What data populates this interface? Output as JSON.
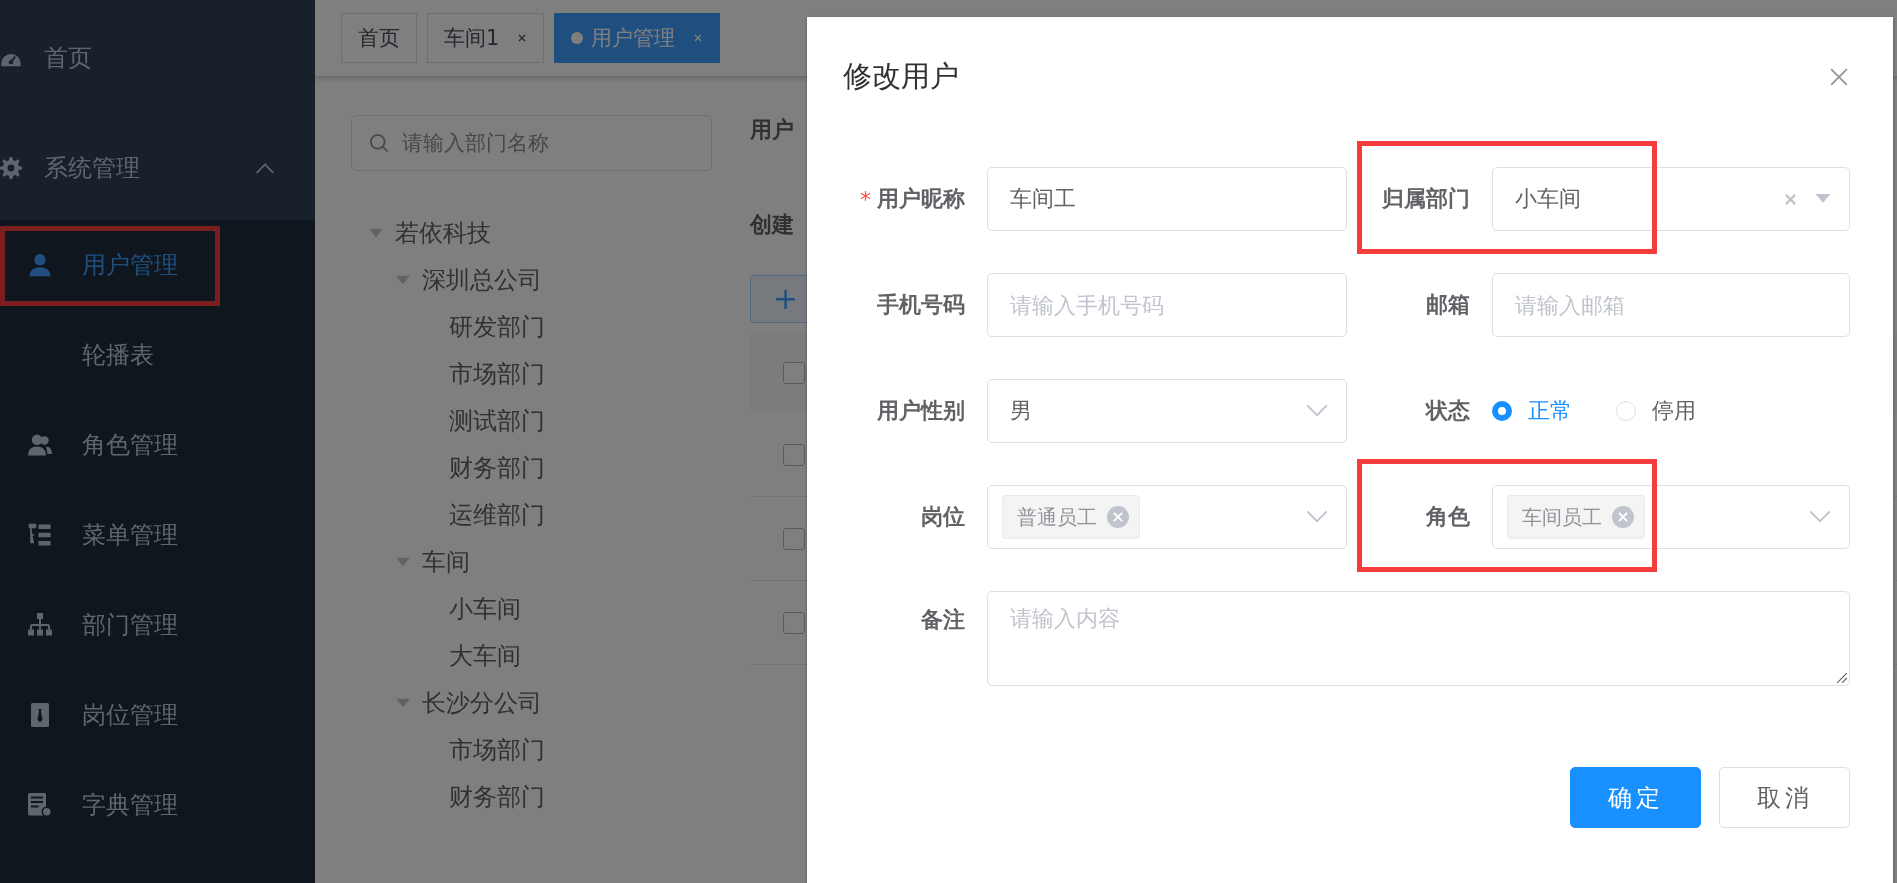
{
  "sidebar": {
    "items": [
      {
        "label": "首页",
        "selected": false
      },
      {
        "label": "系统管理",
        "selected": false,
        "expanded": true,
        "children": [
          {
            "label": "用户管理",
            "selected": true,
            "highlighted": true
          },
          {
            "label": "轮播表",
            "selected": false
          },
          {
            "label": "角色管理",
            "selected": false
          },
          {
            "label": "菜单管理",
            "selected": false
          },
          {
            "label": "部门管理",
            "selected": false
          },
          {
            "label": "岗位管理",
            "selected": false
          },
          {
            "label": "字典管理",
            "selected": false
          }
        ]
      }
    ]
  },
  "tags": [
    {
      "label": "首页",
      "selected": false,
      "closable": false
    },
    {
      "label": "车间1",
      "selected": false,
      "closable": true
    },
    {
      "label": "用户管理",
      "selected": true,
      "closable": true
    }
  ],
  "dept_search": {
    "placeholder": "请输入部门名称"
  },
  "dept_tree": [
    {
      "label": "若依科技",
      "expanded": true,
      "children": [
        {
          "label": "深圳总公司",
          "expanded": true,
          "children": [
            {
              "label": "研发部门"
            },
            {
              "label": "市场部门"
            },
            {
              "label": "测试部门"
            },
            {
              "label": "财务部门"
            },
            {
              "label": "运维部门"
            }
          ]
        },
        {
          "label": "车间",
          "expanded": true,
          "children": [
            {
              "label": "小车间"
            },
            {
              "label": "大车间"
            }
          ]
        },
        {
          "label": "长沙分公司",
          "expanded": true,
          "children": [
            {
              "label": "市场部门"
            },
            {
              "label": "财务部门"
            }
          ]
        }
      ]
    }
  ],
  "query_labels": [
    "用户",
    "创建"
  ],
  "add_button": {
    "label": "+"
  },
  "table": {
    "header_checked": false,
    "rows": [
      {
        "checked": false
      },
      {
        "checked": false
      },
      {
        "checked": false
      }
    ]
  },
  "dialog": {
    "title": "修改用户",
    "fields": [
      {
        "kind": "input",
        "label": "用户昵称",
        "required_mark": "*",
        "value": "车间工"
      },
      {
        "kind": "tree-select",
        "label": "归属部门",
        "value": "小车间",
        "clearable": true,
        "highlighted": true
      },
      {
        "kind": "input",
        "label": "手机号码",
        "placeholder": "请输入手机号码"
      },
      {
        "kind": "input",
        "label": "邮箱",
        "placeholder": "请输入邮箱"
      },
      {
        "kind": "select",
        "label": "用户性别",
        "value": "男"
      },
      {
        "kind": "radio",
        "label": "状态",
        "options": [
          {
            "label": "正常",
            "selected": true
          },
          {
            "label": "停用",
            "selected": false
          }
        ]
      },
      {
        "kind": "multi-select",
        "label": "岗位",
        "tags": [
          "普通员工"
        ]
      },
      {
        "kind": "multi-select",
        "label": "角色",
        "tags": [
          "车间员工"
        ],
        "highlighted": true
      },
      {
        "kind": "textarea",
        "label": "备注",
        "placeholder": "请输入内容"
      }
    ],
    "buttons": [
      {
        "label": "确定",
        "kind": "primary"
      },
      {
        "label": "取消",
        "kind": "default"
      }
    ]
  }
}
